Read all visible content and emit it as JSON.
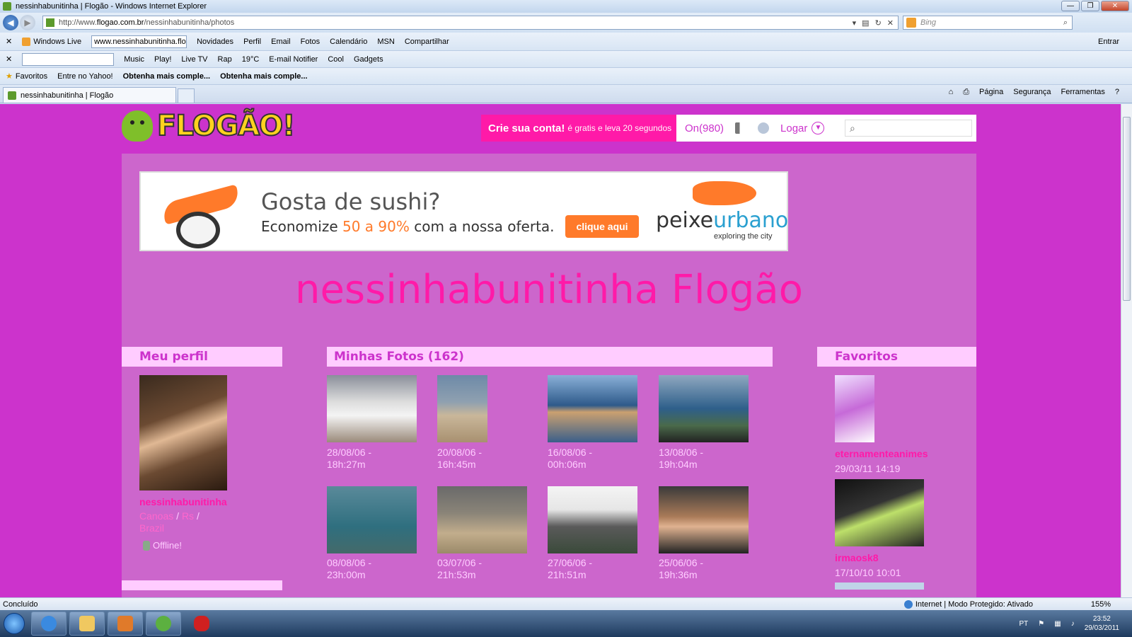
{
  "window": {
    "title": "nessinhabunitinha | Flogão - Windows Internet Explorer",
    "controls": [
      "—",
      "❐",
      "✕"
    ]
  },
  "address_bar": {
    "url_prefix": "http://www.",
    "url_domain": "flogao.com.br",
    "url_path": "/nessinhabunitinha/photos",
    "search_placeholder": "Bing"
  },
  "toolbar_live": {
    "brand": "Windows Live",
    "address_value": "www.nessinhabunitinha.flogao.com.br",
    "items": [
      "Novidades",
      "Perfil",
      "Email",
      "Fotos",
      "Calendário",
      "MSN",
      "Compartilhar"
    ],
    "sign_in": "Entrar"
  },
  "toolbar_media": {
    "items": [
      "Music",
      "Play!",
      "Live TV"
    ],
    "radio": "Rap",
    "temperature": "19°C",
    "email_notifier": "E-mail Notifier",
    "cool": "Cool",
    "gadgets": "Gadgets"
  },
  "favorites_bar": {
    "favorites_label": "Favoritos",
    "items": [
      "Entre no Yahoo!",
      "Obtenha mais comple...",
      "Obtenha mais comple..."
    ]
  },
  "tab": {
    "label": "nessinhabunitinha | Flogão"
  },
  "command_bar": {
    "items": [
      "Página",
      "Segurança",
      "Ferramentas"
    ]
  },
  "site": {
    "logo_text": "FLOGÃO!",
    "signup_bold": "Crie sua conta!",
    "signup_small": "é gratis e leva 20 segundos",
    "online": "On(980)",
    "login": "Logar",
    "ad": {
      "headline": "Gosta de sushi?",
      "line_start": "Economize",
      "line_range": "50 a 90%",
      "line_end": "com a nossa oferta.",
      "cta": "clique aqui",
      "brand_a": "peixe",
      "brand_b": "urbano",
      "brand_sub": "exploring the city"
    },
    "flog_title": "nessinhabunitinha Flogão",
    "profile": {
      "heading": "Meu perfil",
      "username": "nessinhabunitinha",
      "city": "Canoas",
      "state": "Rs",
      "country": "Brazil",
      "status": "Offline!"
    },
    "photos": {
      "heading": "Minhas Fotos (162)",
      "items": [
        {
          "date": "28/08/06 -",
          "time": "18h:27m"
        },
        {
          "date": "20/08/06 -",
          "time": "16h:45m"
        },
        {
          "date": "16/08/06 -",
          "time": "00h:06m"
        },
        {
          "date": "13/08/06 -",
          "time": "19h:04m"
        },
        {
          "date": "08/08/06 -",
          "time": "23h:00m"
        },
        {
          "date": "03/07/06 -",
          "time": "21h:53m"
        },
        {
          "date": "27/06/06 -",
          "time": "21h:51m"
        },
        {
          "date": "25/06/06 -",
          "time": "19h:36m"
        }
      ]
    },
    "favorites": {
      "heading": "Favoritos",
      "items": [
        {
          "name": "eternamenteanimes",
          "date": "29/03/11 14:19"
        },
        {
          "name": "irmaosk8",
          "date": "17/10/10 10:01"
        }
      ]
    }
  },
  "status_bar": {
    "left": "Concluído",
    "zone": "Internet | Modo Protegido: Ativado",
    "zoom": "155%"
  },
  "taskbar": {
    "lang": "PT",
    "time": "23:52",
    "date": "29/03/2011"
  },
  "colors": {
    "page_bg": "#cc33cc",
    "content_bg": "#cc66cc",
    "accent_pink": "#ff1aa8",
    "pale_pink": "#ffccff"
  }
}
